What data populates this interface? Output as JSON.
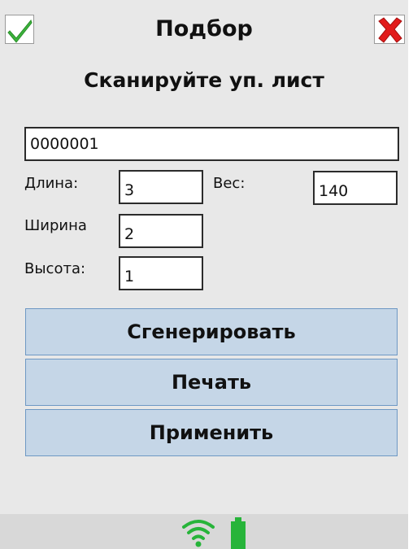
{
  "header": {
    "title": "Подбор",
    "ok_icon": "checkmark-icon",
    "close_icon": "close-icon"
  },
  "subtitle": "Сканируйте уп. лист",
  "scan_field": {
    "value": "0000001"
  },
  "dimensions": {
    "length_label": "Длина:",
    "length_value": "3",
    "weight_label": "Вес:",
    "weight_value": "140",
    "width_label": "Ширина",
    "width_value": "2",
    "height_label": "Высота:",
    "height_value": "1"
  },
  "buttons": {
    "generate": "Сгенерировать",
    "print": "Печать",
    "apply": "Применить"
  },
  "status_bar": {
    "wifi_icon": "wifi-icon",
    "battery_icon": "battery-icon"
  },
  "colors": {
    "button_bg": "#c5d6e7",
    "button_border": "#6e98c4",
    "ok_green": "#3bb33b",
    "close_red": "#e21b1b",
    "status_green": "#27b43a"
  }
}
